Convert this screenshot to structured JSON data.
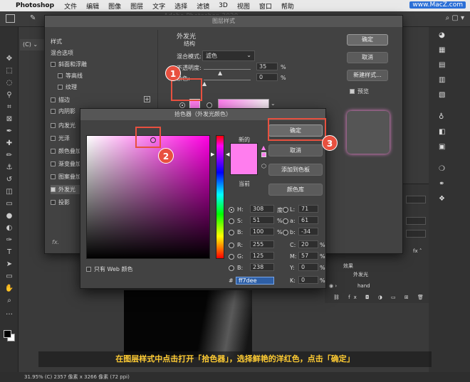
{
  "menubar": {
    "app": "Photoshop",
    "items": [
      "文件",
      "编辑",
      "图像",
      "图层",
      "文字",
      "选择",
      "滤镜",
      "3D",
      "视图",
      "窗口",
      "帮助"
    ],
    "watermark": "www.MacZ.com"
  },
  "window": {
    "bg_title": "Adobe Photoshop 2020",
    "doc_tab": "(C) ⌄"
  },
  "layer_style": {
    "title": "图层样式",
    "styles_header": "样式",
    "blend_options": "混合选项",
    "items": [
      {
        "label": "斜面和浮雕",
        "checked": false
      },
      {
        "label": "等高线",
        "checked": false
      },
      {
        "label": "纹理",
        "checked": false
      },
      {
        "label": "描边",
        "checked": false
      },
      {
        "label": "内阴影",
        "checked": false
      },
      {
        "label": "内发光",
        "checked": false
      },
      {
        "label": "光泽",
        "checked": false
      },
      {
        "label": "颜色叠加",
        "checked": false
      },
      {
        "label": "渐变叠加",
        "checked": false
      },
      {
        "label": "图案叠加",
        "checked": false
      },
      {
        "label": "外发光",
        "checked": true
      },
      {
        "label": "投影",
        "checked": false
      }
    ],
    "fx": "fx.",
    "section_title": "外发光",
    "structure": "结构",
    "blend_mode_label": "混合模式:",
    "blend_mode_value": "滤色",
    "opacity_label": "不透明度:",
    "opacity_value": "35",
    "noise_label": "杂色:",
    "noise_value": "0",
    "percent": "%",
    "glow_color": "#ff7dee",
    "buttons": {
      "ok": "确定",
      "cancel": "取消",
      "new_style": "新建样式..."
    },
    "preview_label": "预览",
    "preview_checked": true
  },
  "color_picker": {
    "title": "拾色器（外发光颜色）",
    "new_label": "新的",
    "current_label": "当前",
    "buttons": {
      "ok": "确定",
      "cancel": "取消",
      "add_swatch": "添加到色板",
      "color_library": "颜色库"
    },
    "web_only": "只有 Web 颜色",
    "hsb": {
      "H": "308",
      "S": "51",
      "B": "100"
    },
    "hsb_units": {
      "H": "度",
      "S": "%",
      "B": "%"
    },
    "lab": {
      "L": "71",
      "a": "61",
      "b": "-34"
    },
    "rgb": {
      "R": "255",
      "G": "125",
      "B": "238"
    },
    "cmyk": {
      "C": "20",
      "M": "57",
      "Y": "0",
      "K": "0"
    },
    "hex_prefix": "#",
    "hex": "ff7dee",
    "selected_color": "#ff7dee"
  },
  "layers_panel": {
    "effects": "效果",
    "outer_glow": "外发光",
    "group": "hand"
  },
  "status": "31.95%    (C) 2357 像素 x 3266 像素 (72 ppi)",
  "callouts": {
    "one": "1",
    "two": "2",
    "three": "3"
  },
  "caption": "在图层样式中点击打开「拾色器」，选择鲜艳的洋红色，点击「确定」",
  "accent_color": "#e8503f"
}
